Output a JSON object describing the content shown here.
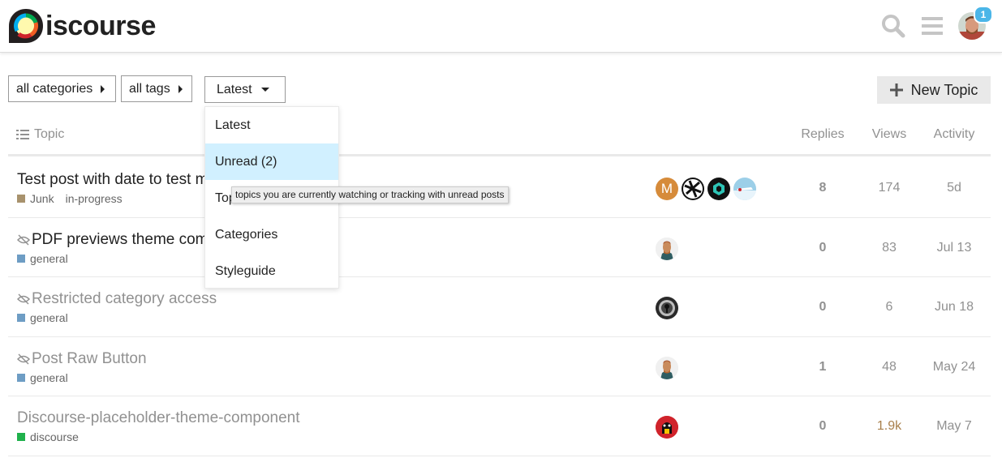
{
  "header": {
    "logo_text": "iscourse",
    "notification_count": "1",
    "icons": [
      "search-icon",
      "hamburger-icon"
    ]
  },
  "navbar": {
    "categories_label": "all categories",
    "tags_label": "all tags",
    "filter_label": "Latest",
    "new_topic_label": "New Topic"
  },
  "table": {
    "col_topic": "Topic",
    "col_replies": "Replies",
    "col_views": "Views",
    "col_activity": "Activity"
  },
  "topics": [
    {
      "title": "Test post with date to test m",
      "category": "Junk",
      "category_color": "#a8926d",
      "tag": "in-progress",
      "replies": "8",
      "views": "174",
      "activity": "5d",
      "read": false,
      "unlisted": false
    },
    {
      "title": "PDF previews theme com",
      "category": "general",
      "category_color": "#6e9dc4",
      "tag": "",
      "replies": "0",
      "views": "83",
      "activity": "Jul 13",
      "read": false,
      "unlisted": true
    },
    {
      "title": "Restricted category access",
      "category": "general",
      "category_color": "#6e9dc4",
      "tag": "",
      "replies": "0",
      "views": "6",
      "activity": "Jun 18",
      "read": true,
      "unlisted": true
    },
    {
      "title": "Post Raw Button",
      "category": "general",
      "category_color": "#6e9dc4",
      "tag": "",
      "replies": "1",
      "views": "48",
      "activity": "May 24",
      "read": true,
      "unlisted": true
    },
    {
      "title": "Discourse-placeholder-theme-component",
      "category": "discourse",
      "category_color": "#20b14c",
      "tag": "",
      "replies": "0",
      "views": "1.9k",
      "activity": "May 7",
      "read": true,
      "unlisted": false
    }
  ],
  "poster_initial": "M",
  "menu": {
    "items": [
      "Latest",
      "Unread (2)",
      "Top",
      "Categories",
      "Styleguide"
    ]
  },
  "tooltip": "topics you are currently watching or tracking with unread posts",
  "colors": {
    "accent_highlight": "#d1f0ff",
    "badge": "#4bb6e8",
    "hot_views": "#a87f4b"
  }
}
